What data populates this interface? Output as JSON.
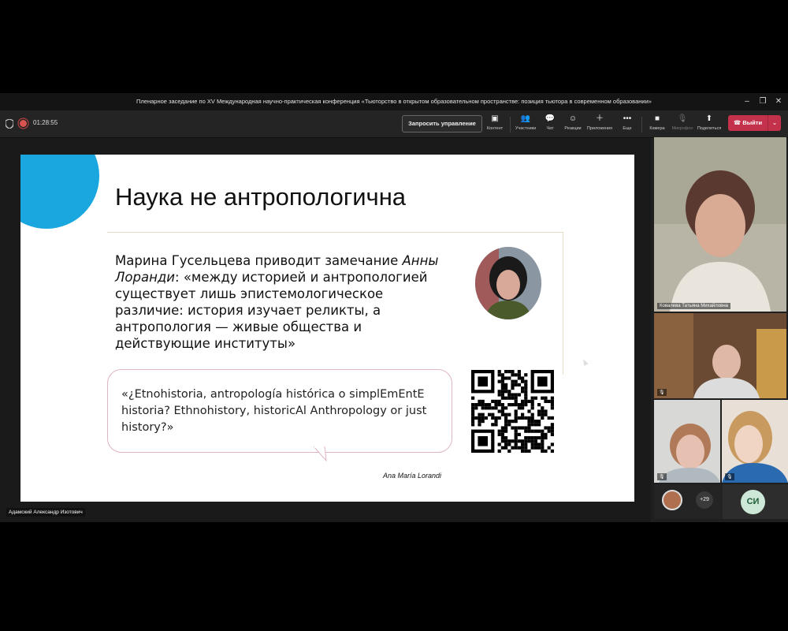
{
  "window": {
    "title": "Пленарное заседание по XV Международная научно-практическая конференция «Тьюторство в открытом образовательном пространстве: позиция тьютора в современном образовании»",
    "minimize": "–",
    "maximize": "❐",
    "close": "✕"
  },
  "toolbar": {
    "timer": "01:28:55",
    "request_control": "Запросить управление",
    "items": [
      {
        "label": "Контент",
        "icon": "share-content-icon"
      },
      {
        "label": "Участники",
        "icon": "people-icon"
      },
      {
        "label": "Чат",
        "icon": "chat-icon"
      },
      {
        "label": "Реакции",
        "icon": "reaction-icon"
      },
      {
        "label": "Приложения",
        "icon": "apps-icon"
      },
      {
        "label": "Еще",
        "icon": "more-icon"
      },
      {
        "label": "Камера",
        "icon": "camera-icon"
      },
      {
        "label": "Микрофон",
        "icon": "mic-off-icon"
      },
      {
        "label": "Поделиться",
        "icon": "share-icon"
      }
    ],
    "leave": "Выйти",
    "leave_color": "#c4314b"
  },
  "slide": {
    "title": "Наука не антропологична",
    "quote_part1": "Марина Гусельцева приводит замечание ",
    "quote_name": "Анны Лоранди",
    "quote_part2": ": «между историей и антропологией существует лишь эпистемологическое различие: история изучает реликты, а антропология — живые общества и действующие институты»",
    "bubble_text": "«¿Etnohistoria, antropología histórica o simplEmEntE historia? Ethnohistory, historicAl Anthropology or just history?»",
    "author": "Ana María Lorandi",
    "accent_color": "#1aa7e0"
  },
  "presenter": {
    "name": "Адамский Александр Изотович"
  },
  "participants": {
    "main_tile_name": "Ковалева Татьяна Михайловна",
    "more_count": "+29",
    "initials": "СИ"
  }
}
